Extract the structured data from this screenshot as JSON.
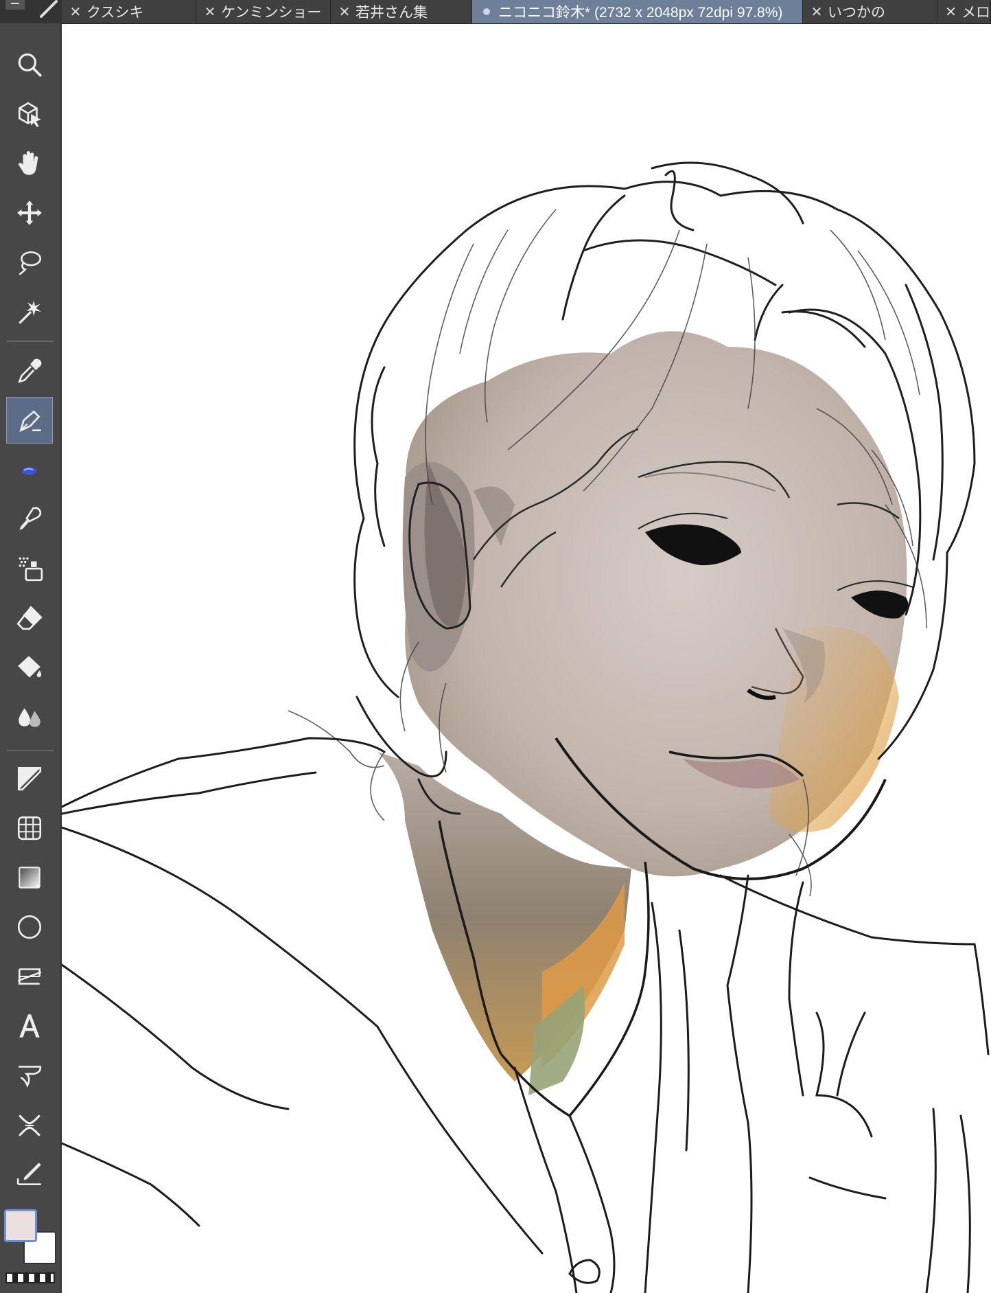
{
  "tabs": [
    {
      "label": "クスシキ",
      "active": false
    },
    {
      "label": "ケンミンショー",
      "active": false
    },
    {
      "label": "若井さん集",
      "active": false
    },
    {
      "label": "ニコニコ鈴木* (2732 x 2048px 72dpi 97.8%)",
      "active": true
    },
    {
      "label": "いつかの",
      "active": false
    },
    {
      "label": "メロ",
      "active": false
    }
  ],
  "tools": [
    "zoom-icon",
    "object-select-icon",
    "hand-icon",
    "move-icon",
    "lasso-icon",
    "magic-wand-icon",
    "eyedropper-icon",
    "pen-icon",
    "pencil-icon",
    "brush-icon",
    "airbrush-icon",
    "eraser-icon",
    "fill-icon",
    "blend-icon",
    "frame-border-icon",
    "ruler-icon",
    "gradient-icon",
    "shape-ellipse-icon",
    "layer-move-icon",
    "text-icon",
    "balloon-icon",
    "correct-line-icon",
    "draw-line-icon"
  ],
  "active_tool": "pen-icon",
  "colors": {
    "foreground": "#ece0de",
    "background": "#ffffff",
    "accent": "#6e7f99"
  }
}
